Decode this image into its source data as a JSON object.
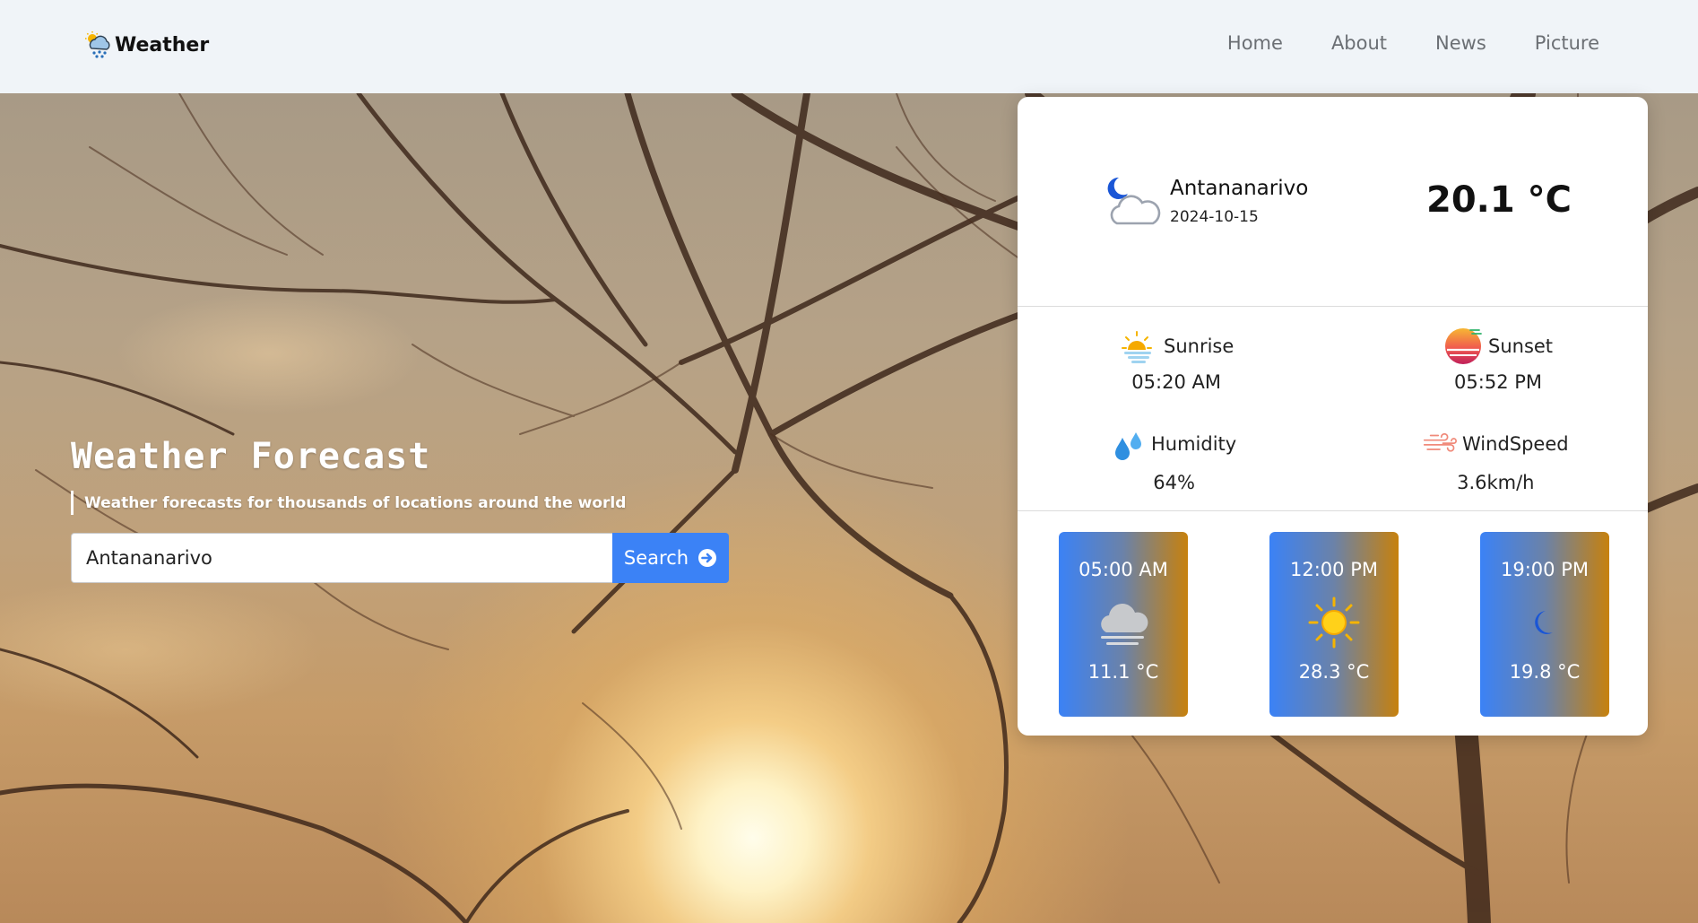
{
  "navbar": {
    "brand": "Weather",
    "brand_icon": "rain-cloud-sun-icon",
    "links": [
      {
        "label": "Home"
      },
      {
        "label": "About"
      },
      {
        "label": "News"
      },
      {
        "label": "Picture"
      }
    ]
  },
  "hero": {
    "title": "Weather Forecast",
    "subtitle": "Weather forecasts for thousands of locations around the world",
    "search": {
      "value": "Antananarivo",
      "button_label": "Search",
      "button_icon": "arrow-circle-right-icon"
    }
  },
  "current": {
    "icon": "moon-cloud-icon",
    "city": "Antananarivo",
    "date": "2024-10-15",
    "temperature": "20.1 °C"
  },
  "details": {
    "sunrise": {
      "label": "Sunrise",
      "value": "05:20 AM",
      "icon": "sunrise-icon"
    },
    "sunset": {
      "label": "Sunset",
      "value": "05:52 PM",
      "icon": "sunset-icon"
    },
    "humidity": {
      "label": "Humidity",
      "value": "64%",
      "icon": "water-drops-icon"
    },
    "windspeed": {
      "label": "WindSpeed",
      "value": "3.6km/h",
      "icon": "wind-icon"
    }
  },
  "hourly": [
    {
      "time": "05:00 AM",
      "temp": "11.1 °C",
      "icon": "fog-cloud-icon"
    },
    {
      "time": "12:00 PM",
      "temp": "28.3 °C",
      "icon": "sun-icon"
    },
    {
      "time": "19:00 PM",
      "temp": "19.8 °C",
      "icon": "moon-icon"
    }
  ],
  "colors": {
    "accent": "#3b82f6",
    "hour_gradient_end": "#c7810d",
    "navbar_bg": "#f0f4f8"
  }
}
